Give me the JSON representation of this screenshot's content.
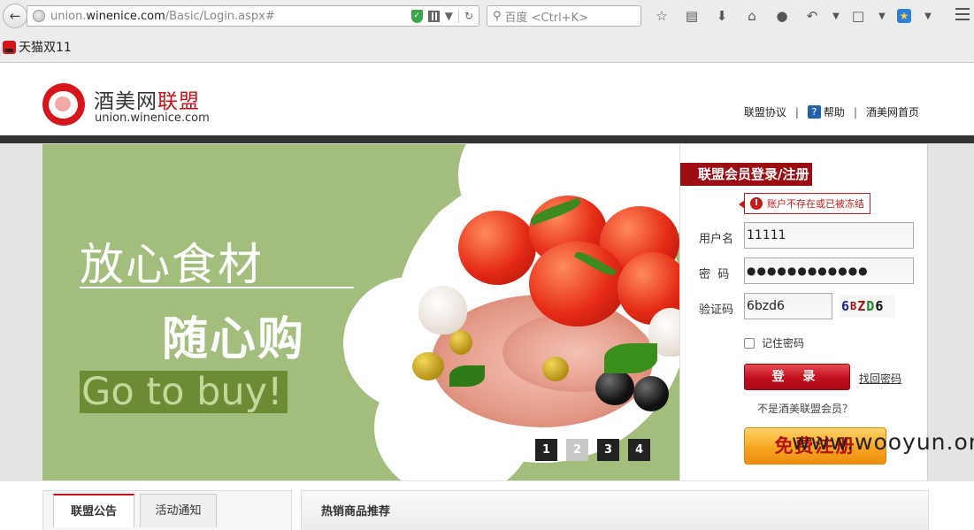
{
  "browser": {
    "url_prefix": "union.",
    "url_domain": "winenice.com",
    "url_path": "/Basic/Login.aspx#",
    "search_placeholder": "百度 <Ctrl+K>",
    "bookmark_label": "天猫双11"
  },
  "header": {
    "logo_name_black": "酒美网",
    "logo_name_red": "联盟",
    "logo_domain": "union.winenice.com",
    "links": {
      "agreement": "联盟协议",
      "help": "帮助",
      "home": "酒美网首页",
      "separator": "|"
    }
  },
  "banner": {
    "slogan_1": "放心食材",
    "slogan_2": "随心购",
    "slogan_3": "Go to buy!",
    "pages": [
      "1",
      "2",
      "3",
      "4"
    ],
    "active_page": "2"
  },
  "login": {
    "title": "联盟会员登录/注册",
    "error_message": "账户不存在或已被冻结",
    "username_label": "用户名",
    "username_value": "11111",
    "password_label": "密  码",
    "password_value": "●●●●●●●●●●●●",
    "captcha_label": "验证码",
    "captcha_value": "6bzd6",
    "captcha_image": {
      "c1": "6",
      "c2": "B",
      "c3": "Z",
      "c4": "D",
      "c5": "6"
    },
    "remember_label": "记住密码",
    "login_button": "登 录",
    "forgot_link": "找回密码",
    "not_member": "不是酒美联盟会员？",
    "register_button": "免费注册"
  },
  "bottom": {
    "tab_1": "联盟公告",
    "tab_2": "活动通知",
    "hot_title": "热销商品推荐"
  },
  "watermark": "www.wooyun.org",
  "colors": {
    "brand_red": "#c4131a",
    "banner_green": "#a3bd7c",
    "register_orange": "#f7a521"
  }
}
